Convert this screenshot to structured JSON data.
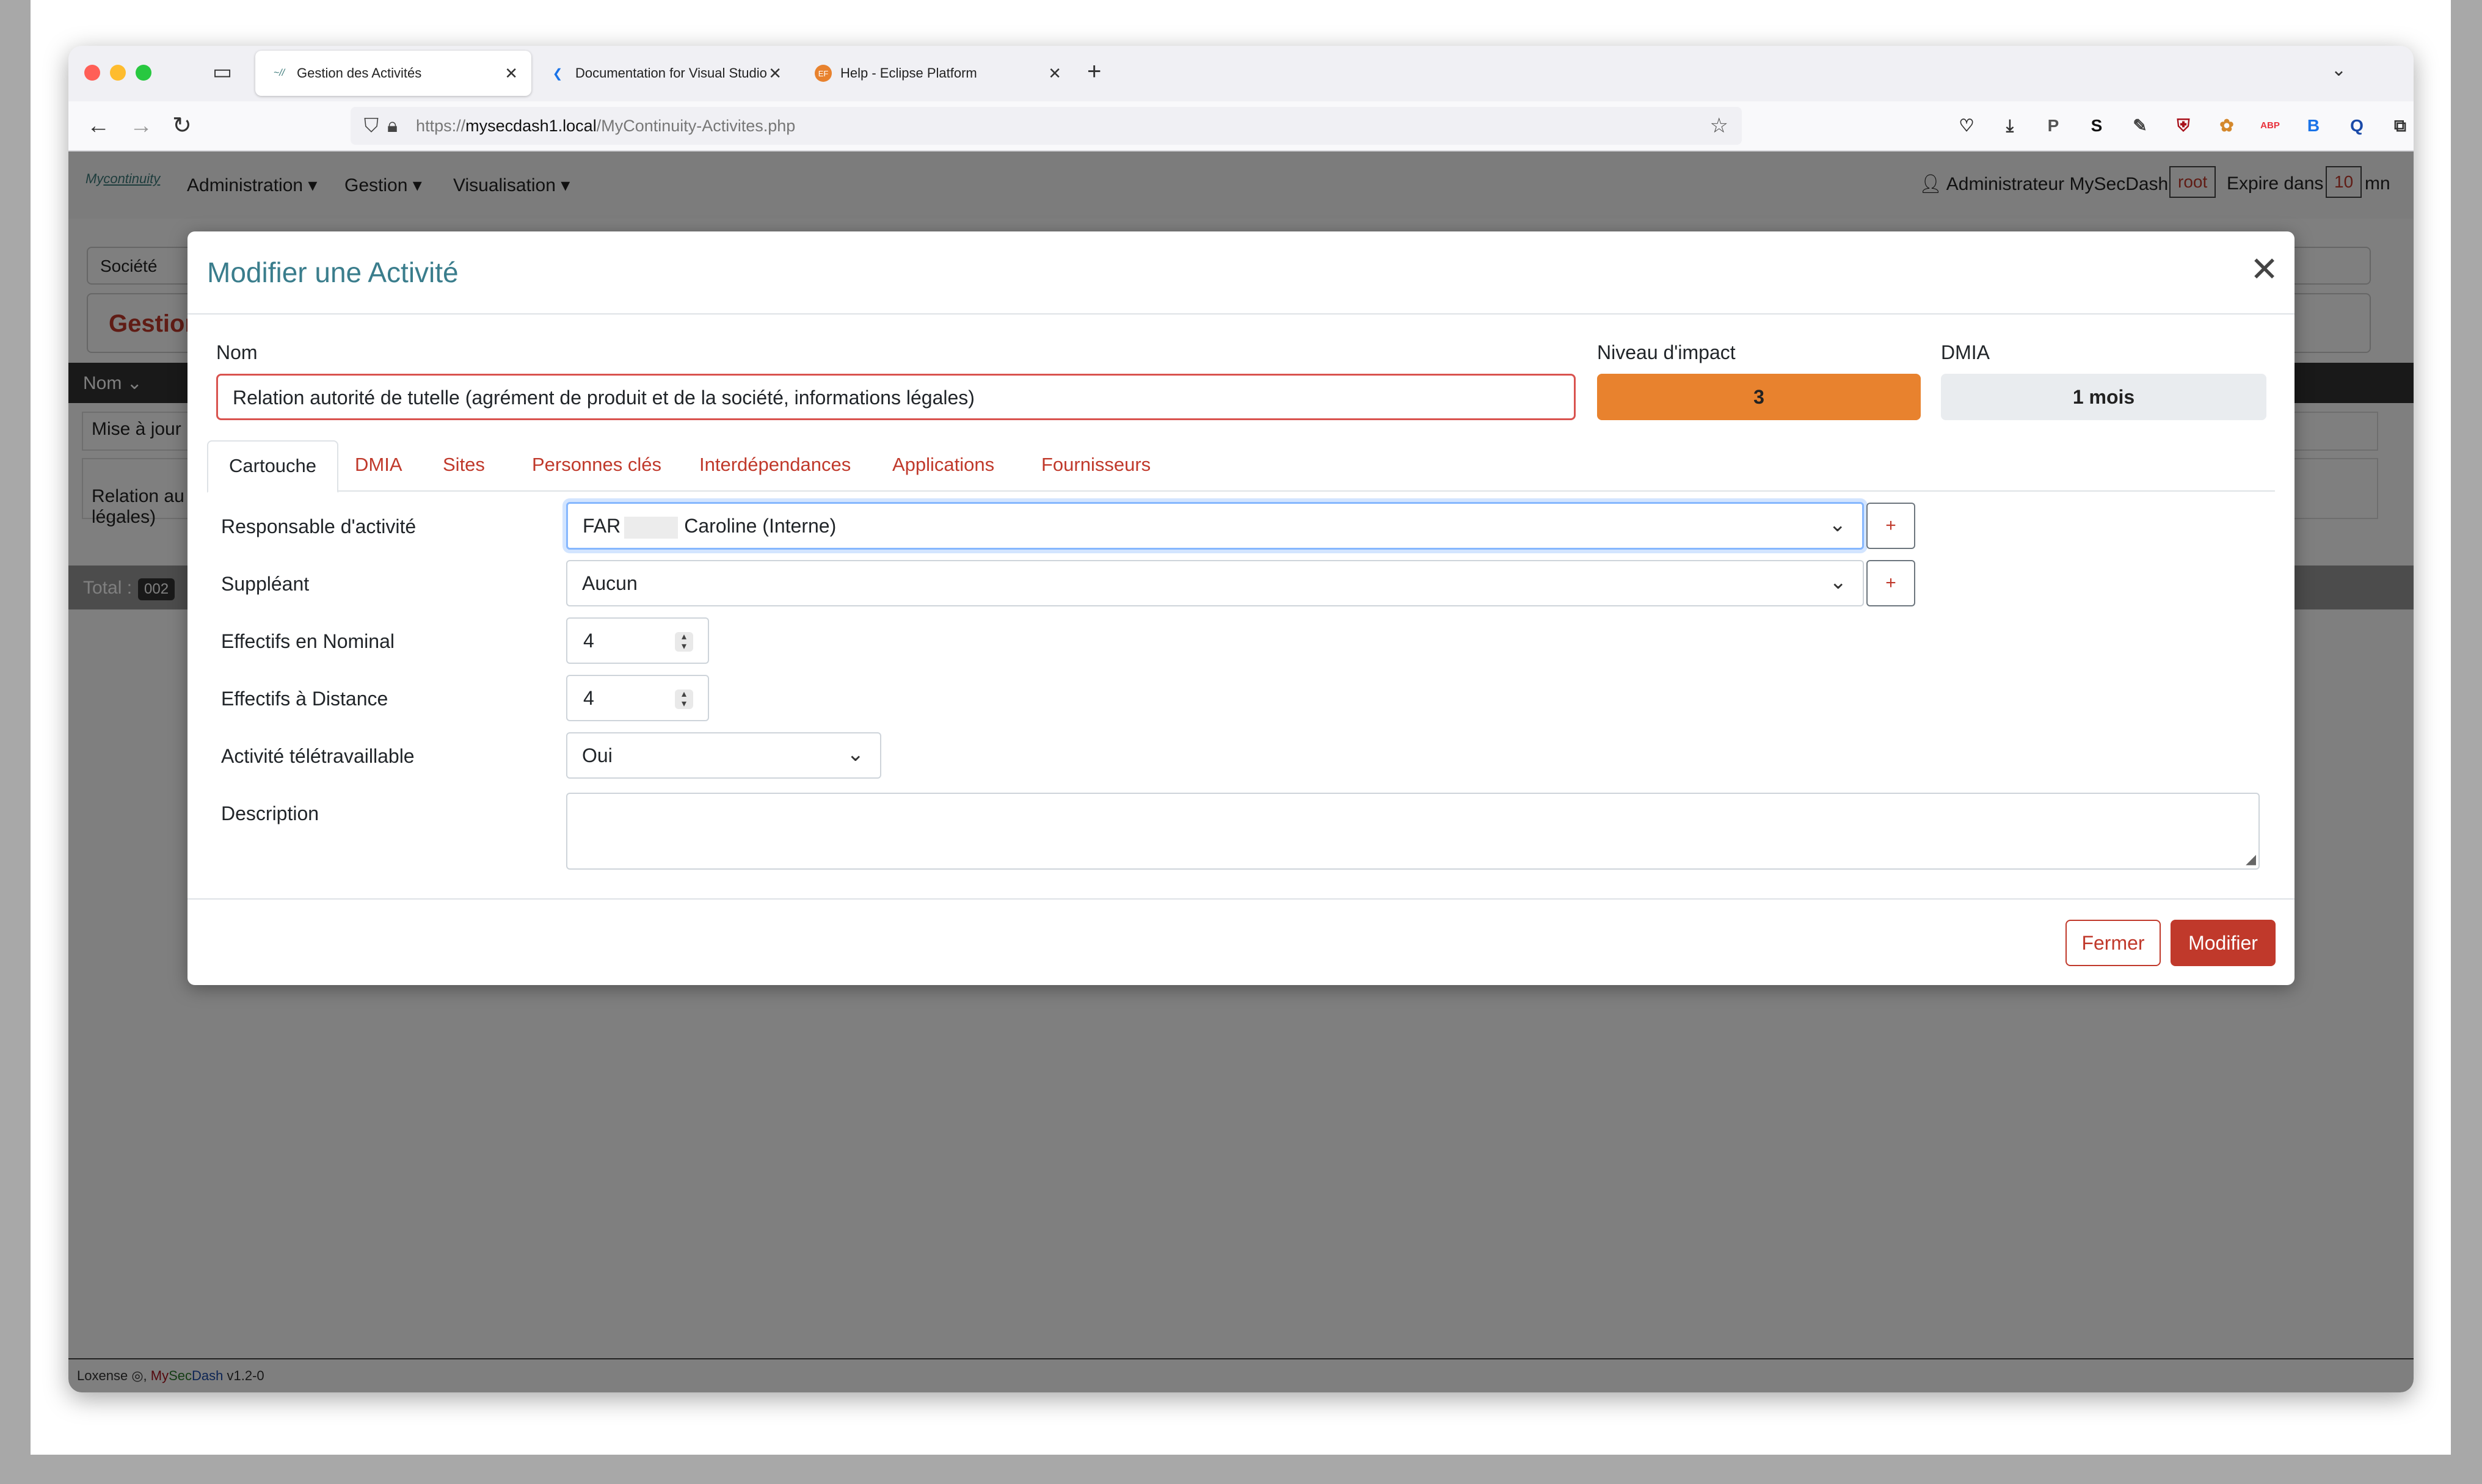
{
  "browser": {
    "tabs": [
      {
        "title": "Gestion des Activités",
        "icon": "mycontinuity-logo-icon",
        "active": true
      },
      {
        "title": "Documentation for Visual Studio",
        "icon": "vscode-icon",
        "active": false
      },
      {
        "title": "Help - Eclipse Platform",
        "icon": "eclipse-icon",
        "icon_text": "EF",
        "active": false
      }
    ],
    "url_prefix": "https://",
    "url_host": "mysecdash1.local",
    "url_path": "/MyContinuity-Activites.php",
    "extensions": [
      {
        "name": "pocket-icon",
        "glyph": "♡",
        "color": "#333333"
      },
      {
        "name": "download-icon",
        "glyph": "⤓",
        "color": "#333333"
      },
      {
        "name": "p-extension-icon",
        "glyph": "P",
        "color": "#555555"
      },
      {
        "name": "s-extension-icon",
        "glyph": "S",
        "color": "#111111"
      },
      {
        "name": "eyedropper-icon",
        "glyph": "✎",
        "color": "#444444"
      },
      {
        "name": "ublock-icon",
        "glyph": "⛨",
        "color": "#a8101a"
      },
      {
        "name": "squirrel-icon",
        "glyph": "✿",
        "color": "#d4882c"
      },
      {
        "name": "abp-icon",
        "glyph": "ABP",
        "color": "#e8313b"
      },
      {
        "name": "b-extension-icon",
        "glyph": "B",
        "color": "#1a73e8"
      },
      {
        "name": "q-extension-icon",
        "glyph": "Q",
        "color": "#1a4aa8"
      },
      {
        "name": "extensions-icon",
        "glyph": "⧉",
        "color": "#333333"
      },
      {
        "name": "menu-icon",
        "glyph": "≡",
        "color": "#333333"
      }
    ]
  },
  "app": {
    "menu": [
      "Administration ▾",
      "Gestion ▾",
      "Visualisation ▾"
    ],
    "user": "Administrateur MySecDash",
    "user_login": "root",
    "expire_label": "Expire dans",
    "expire_value": "10",
    "expire_unit": "mn",
    "filter_label": "Société",
    "page_heading": "Gestion",
    "table_header": "Nom",
    "rows": [
      "Mise à jour",
      "Relation au\nlégales)"
    ],
    "total_label": "Total :",
    "total_count": "002",
    "footer_company": "Loxense",
    "footer_my": "My",
    "footer_sec": "Sec",
    "footer_dash": "Dash",
    "footer_version": "v1.2-0"
  },
  "modal": {
    "title": "Modifier une Activité",
    "name_label": "Nom",
    "name_value": "Relation autorité de tutelle (agrément de produit et de la société, informations légales)",
    "impact_label": "Niveau d'impact",
    "impact_value": "3",
    "impact_color": "#e8822e",
    "dmia_label": "DMIA",
    "dmia_value": "1 mois",
    "tabs": [
      "Cartouche",
      "DMIA",
      "Sites",
      "Personnes clés",
      "Interdépendances",
      "Applications",
      "Fournisseurs"
    ],
    "active_tab": "Cartouche",
    "fields": {
      "responsable_label": "Responsable d'activité",
      "responsable_prefix": "FAR",
      "responsable_suffix": "Caroline (Interne)",
      "suppleant_label": "Suppléant",
      "suppleant_value": "Aucun",
      "nominal_label": "Effectifs en Nominal",
      "nominal_value": "4",
      "distance_label": "Effectifs à Distance",
      "distance_value": "4",
      "teletravail_label": "Activité télétravaillable",
      "teletravail_value": "Oui",
      "description_label": "Description",
      "description_value": ""
    },
    "plus_label": "+",
    "close_label": "Fermer",
    "submit_label": "Modifier"
  }
}
